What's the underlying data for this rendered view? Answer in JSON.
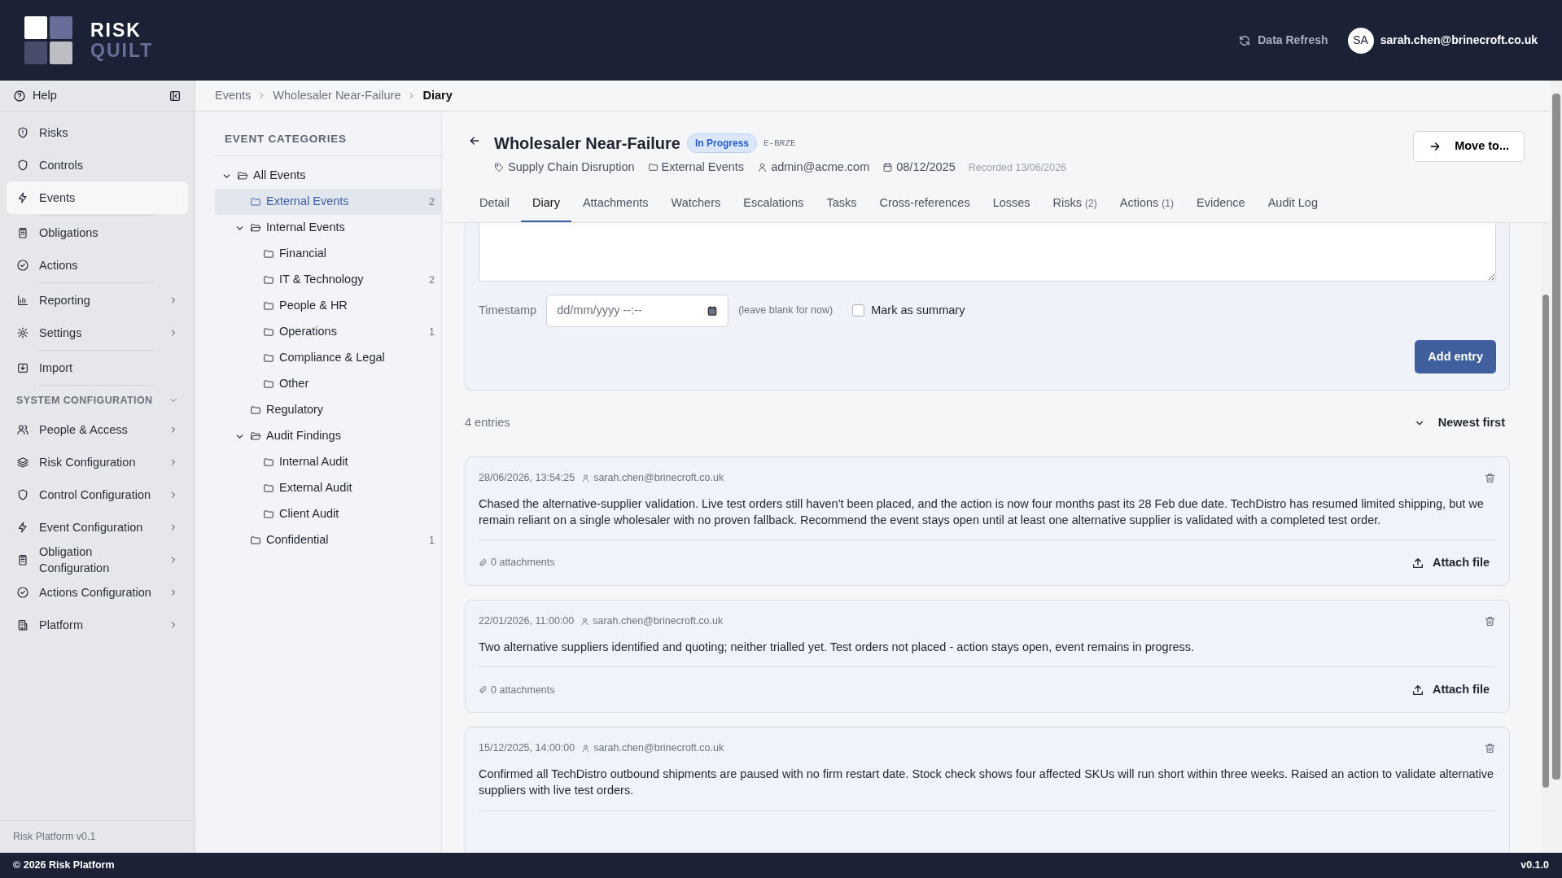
{
  "app": {
    "logo_top": "RISK",
    "logo_bottom": "QUILT",
    "refresh": "Data Refresh",
    "avatar": "SA",
    "user": "sarah.chen@brinecroft.co.uk"
  },
  "sidebar": {
    "help": "Help",
    "items": [
      {
        "kind": "link",
        "label": "Risks",
        "selected": false
      },
      {
        "kind": "link",
        "label": "Controls",
        "selected": false
      },
      {
        "kind": "link",
        "label": "Events",
        "selected": true
      },
      {
        "kind": "divider"
      },
      {
        "kind": "link",
        "label": "Obligations",
        "selected": false
      },
      {
        "kind": "link",
        "label": "Actions",
        "selected": false
      },
      {
        "kind": "divider"
      },
      {
        "kind": "group",
        "label": "Reporting",
        "selected": false
      },
      {
        "kind": "group",
        "label": "Settings",
        "selected": false
      },
      {
        "kind": "divider"
      },
      {
        "kind": "link",
        "label": "Import",
        "selected": false
      },
      {
        "kind": "divider"
      },
      {
        "kind": "section",
        "label": "SYSTEM CONFIGURATION",
        "expanded": true
      },
      {
        "kind": "group",
        "label": "People & Access",
        "selected": false
      },
      {
        "kind": "group",
        "label": "Risk Configuration",
        "selected": false
      },
      {
        "kind": "group",
        "label": "Control Configuration",
        "selected": false
      },
      {
        "kind": "group",
        "label": "Event Configuration",
        "selected": false
      },
      {
        "kind": "group",
        "label": "Obligation Configuration",
        "selected": false
      },
      {
        "kind": "group",
        "label": "Actions Configuration",
        "selected": false
      },
      {
        "kind": "group",
        "label": "Platform",
        "selected": false
      }
    ],
    "version": "Risk Platform v0.1"
  },
  "breadcrumb": [
    "Events",
    "Wholesaler Near-Failure",
    "Diary"
  ],
  "categories": {
    "title": "EVENT CATEGORIES",
    "tree": [
      {
        "label": "All Events",
        "selected": false,
        "expanded": true,
        "children": [
          {
            "label": "External Events",
            "count": "2",
            "selected": true
          },
          {
            "label": "Internal Events",
            "selected": false,
            "expanded": true,
            "children": [
              {
                "label": "Financial",
                "selected": false
              },
              {
                "label": "IT & Technology",
                "count": "2",
                "selected": false
              },
              {
                "label": "People & HR",
                "selected": false
              },
              {
                "label": "Operations",
                "count": "1",
                "selected": false
              },
              {
                "label": "Compliance & Legal",
                "selected": false
              },
              {
                "label": "Other",
                "selected": false
              }
            ]
          },
          {
            "label": "Regulatory",
            "selected": false
          },
          {
            "label": "Audit Findings",
            "selected": false,
            "expanded": true,
            "children": [
              {
                "label": "Internal Audit",
                "selected": false
              },
              {
                "label": "External Audit",
                "selected": false
              },
              {
                "label": "Client Audit",
                "selected": false
              }
            ]
          },
          {
            "label": "Confidential",
            "count": "1",
            "selected": false
          }
        ]
      }
    ]
  },
  "event": {
    "title": "Wholesaler Near-Failure",
    "status": "In Progress",
    "code": "E-BRZE",
    "meta": [
      "Supply Chain Disruption",
      "External Events",
      "admin@acme.com",
      "08/12/2025"
    ],
    "recorded": "Recorded 13/06/2026",
    "move_button": "Move to..."
  },
  "tabs": [
    {
      "label": "Detail",
      "selected": false
    },
    {
      "label": "Diary",
      "selected": true
    },
    {
      "label": "Attachments",
      "selected": false
    },
    {
      "label": "Watchers",
      "selected": false
    },
    {
      "label": "Escalations",
      "selected": false
    },
    {
      "label": "Tasks",
      "selected": false
    },
    {
      "label": "Cross-references",
      "selected": false
    },
    {
      "label": "Losses",
      "selected": false
    },
    {
      "label": "Risks",
      "count": "(2)",
      "selected": false
    },
    {
      "label": "Actions",
      "count": "(1)",
      "selected": false
    },
    {
      "label": "Evidence",
      "selected": false
    },
    {
      "label": "Audit Log",
      "selected": false
    }
  ],
  "form": {
    "timestamp_label": "Timestamp",
    "timestamp_placeholder": "dd/mm/yyyy --:--",
    "hint": "(leave blank for now)",
    "summary_label": "Mark as summary",
    "summary_checked": false,
    "submit": "Add entry"
  },
  "entries_count": "4 entries",
  "sort": "Newest first",
  "entries": [
    {
      "timestamp": "28/06/2026, 13:54:25",
      "author": "sarah.chen@brinecroft.co.uk",
      "text": "Chased the alternative-supplier validation. Live test orders still haven't been placed, and the action is now four months past its 28 Feb due date. TechDistro has resumed limited shipping, but we remain reliant on a single wholesaler with no proven fallback. Recommend the event stays open until at least one alternative supplier is validated with a completed test order.",
      "attachments": "0 attachments",
      "attach_button": "Attach file"
    },
    {
      "timestamp": "22/01/2026, 11:00:00",
      "author": "sarah.chen@brinecroft.co.uk",
      "text": "Two alternative suppliers identified and quoting; neither trialled yet. Test orders not placed - action stays open, event remains in progress.",
      "attachments": "0 attachments",
      "attach_button": "Attach file"
    },
    {
      "timestamp": "15/12/2025, 14:00:00",
      "author": "sarah.chen@brinecroft.co.uk",
      "text": "Confirmed all TechDistro outbound shipments are paused with no firm restart date. Stock check shows four affected SKUs will run short within three weeks. Raised an action to validate alternative suppliers with live test orders."
    }
  ],
  "footer": {
    "copyright": "© 2026 Risk Platform",
    "version": "v0.1.0"
  }
}
